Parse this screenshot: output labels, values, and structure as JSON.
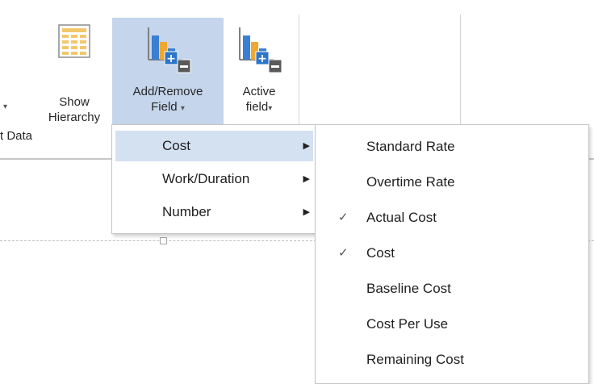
{
  "ribbon": {
    "group_label": "t Data",
    "show_hierarchy": {
      "line1": "Show",
      "line2": "Hierarchy",
      "icon": "hierarchy-grid-icon"
    },
    "add_remove_field": {
      "line1": "Add/Remove",
      "line2": "Field",
      "caret": "▾",
      "icon": "add-remove-field-chart-icon"
    },
    "active_field": {
      "line1": "Active",
      "line2": "field",
      "caret": "▾",
      "icon": "active-field-chart-icon"
    }
  },
  "field_menu": {
    "items": [
      {
        "label": "Cost",
        "arrow": "▶",
        "selected": true
      },
      {
        "label": "Work/Duration",
        "arrow": "▶",
        "selected": false
      },
      {
        "label": "Number",
        "arrow": "▶",
        "selected": false
      }
    ]
  },
  "cost_submenu": {
    "items": [
      {
        "label": "Standard Rate",
        "checked": false,
        "check": ""
      },
      {
        "label": "Overtime Rate",
        "checked": false,
        "check": ""
      },
      {
        "label": "Actual Cost",
        "checked": true,
        "check": "✓"
      },
      {
        "label": "Cost",
        "checked": true,
        "check": "✓"
      },
      {
        "label": "Baseline Cost",
        "checked": false,
        "check": ""
      },
      {
        "label": "Cost Per Use",
        "checked": false,
        "check": ""
      },
      {
        "label": "Remaining Cost",
        "checked": false,
        "check": ""
      }
    ]
  },
  "colors": {
    "highlight": "#c4d5ec",
    "menu_selected": "#d4e1f1",
    "chart_blue": "#3a7fd1",
    "chart_orange": "#f0a830",
    "chart_gray": "#8c8c8c"
  }
}
